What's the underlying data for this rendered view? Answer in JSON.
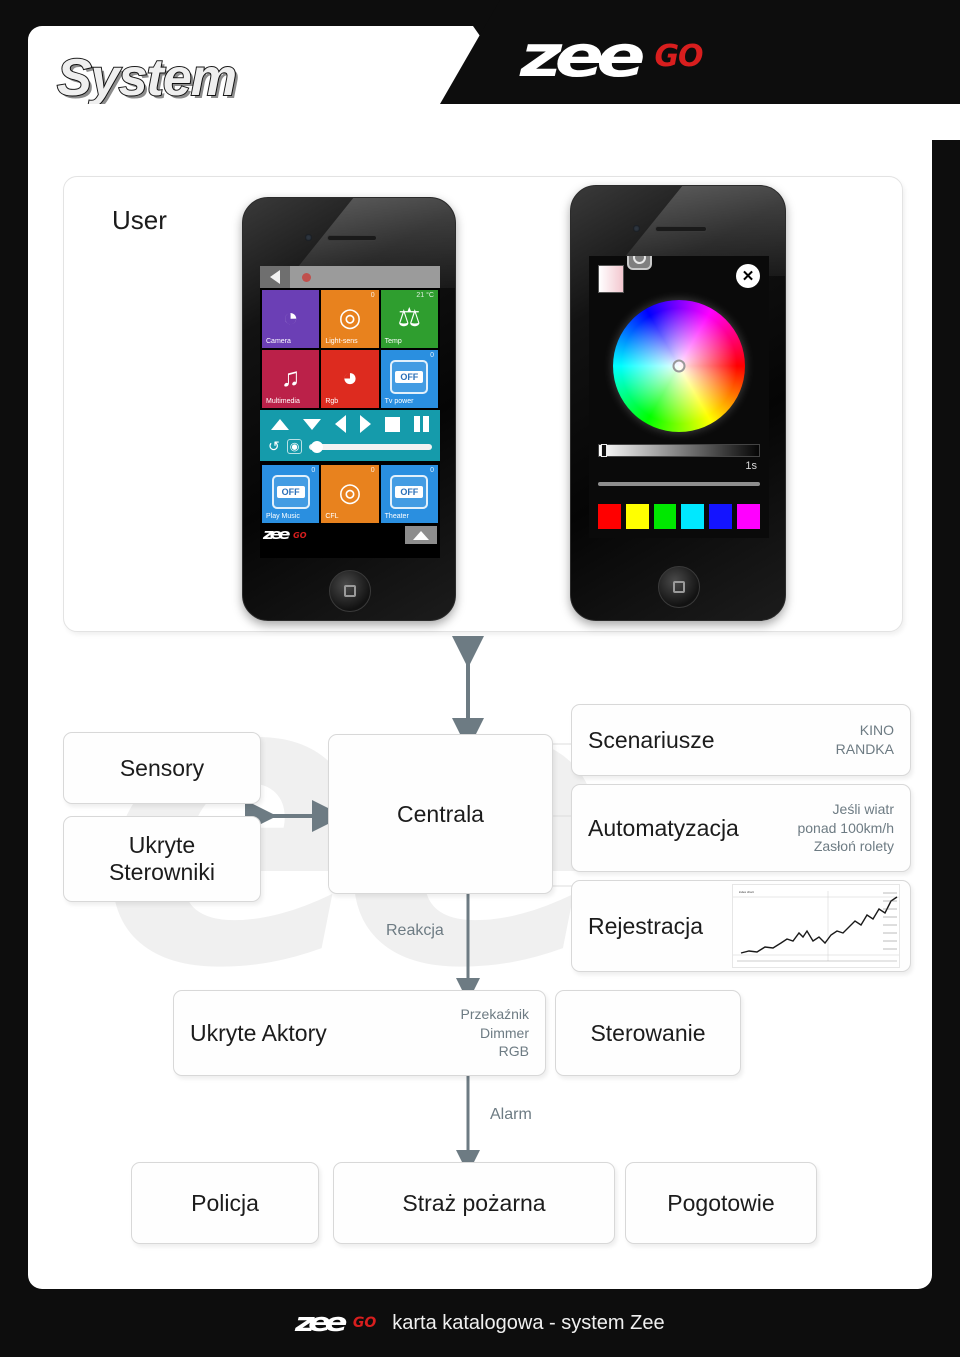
{
  "header": {
    "title": "System",
    "logo_zee": "zee",
    "logo_go": "GO"
  },
  "colors": {
    "brand_red": "#d81e1e",
    "arrow_slate": "#6d7b83",
    "panel_border": "#d8d8d8",
    "page_black": "#0d0d0d"
  },
  "user_panel": {
    "label": "User"
  },
  "phone1": {
    "appbar": {
      "back_icon": "back-arrow-icon",
      "rec_icon": "record-dot-icon"
    },
    "tiles": [
      {
        "label": "Camera",
        "corner": "",
        "color": "#6b3fb5",
        "glyph": "camera-dome-icon",
        "state": ""
      },
      {
        "label": "Light-sens",
        "corner": "0",
        "color": "#e8821e",
        "glyph": "light-sensor-icon",
        "state": ""
      },
      {
        "label": "Temp",
        "corner": "21 °C",
        "color": "#2f9e2f",
        "glyph": "thermometer-icon",
        "state": ""
      },
      {
        "label": "Multimedia",
        "corner": "",
        "color": "#bb2149",
        "glyph": "music-note-icon",
        "state": ""
      },
      {
        "label": "Rgb",
        "corner": "",
        "color": "#dd2b1f",
        "glyph": "rgb-palette-icon",
        "state": ""
      },
      {
        "label": "Tv power",
        "corner": "0",
        "color": "#2a8fe0",
        "glyph": "switch-icon",
        "state": "OFF"
      },
      {
        "label": "Play Music",
        "corner": "0",
        "color": "#2a8fe0",
        "glyph": "switch-icon",
        "state": "OFF"
      },
      {
        "label": "CFL",
        "corner": "0",
        "color": "#e8821e",
        "glyph": "light-sensor-icon",
        "state": ""
      },
      {
        "label": "Theater",
        "corner": "0",
        "color": "#2a8fe0",
        "glyph": "switch-icon",
        "state": "OFF"
      }
    ],
    "controls": {
      "up": "up-arrow-icon",
      "down": "down-arrow-icon",
      "left": "left-arrow-icon",
      "right": "right-arrow-icon",
      "stop": "stop-icon",
      "pause": "pause-icon",
      "refresh": "refresh-icon",
      "snapshot": "snapshot-icon"
    },
    "footer_logo_zee": "zee",
    "footer_logo_go": "GO"
  },
  "phone2": {
    "close_label": "✕",
    "time_label": "1s",
    "swatches": [
      "#ff0000",
      "#ffff00",
      "#00e800",
      "#00e8ff",
      "#1414ff",
      "#ff00ff"
    ],
    "ok_label": "✔",
    "save_icon": "floppy-disk-icon"
  },
  "diagram": {
    "sensory": "Sensory",
    "ukryte_sterowniki": "Ukryte\nSterowniki",
    "ukryte_sterowniki_line1": "Ukryte",
    "ukryte_sterowniki_line2": "Sterowniki",
    "centrala": "Centrala",
    "reakcja": "Reakcja",
    "alarm": "Alarm",
    "scenariusze": {
      "title": "Scenariusze",
      "sub_line1": "KINO",
      "sub_line2": "RANDKA"
    },
    "automatyzacja": {
      "title": "Automatyzacja",
      "sub_line1": "Jeśli wiatr",
      "sub_line2": "ponad 100km/h",
      "sub_line3": "Zasłoń rolety"
    },
    "rejestracja": {
      "title": "Rejestracja",
      "chart_icon": "stock-chart-icon"
    },
    "ukryte_aktory": {
      "title": "Ukryte Aktory",
      "sub_line1": "Przekaźnik",
      "sub_line2": "Dimmer",
      "sub_line3": "RGB"
    },
    "sterowanie": "Sterowanie",
    "emergency": [
      "Policja",
      "Straż pożarna",
      "Pogotowie"
    ]
  },
  "footer": {
    "logo_zee": "zee",
    "logo_go": "GO",
    "text": "karta katalogowa - system Zee"
  }
}
